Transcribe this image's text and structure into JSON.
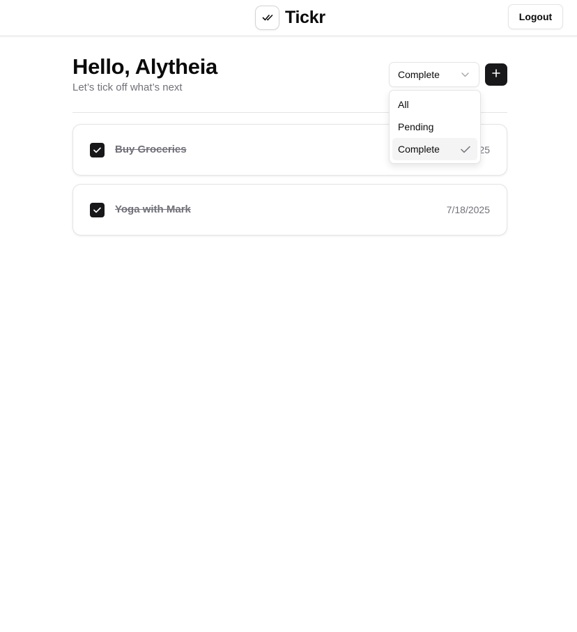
{
  "header": {
    "app_name": "Tickr",
    "logo_icon": "double-check-icon",
    "logout_label": "Logout"
  },
  "main": {
    "greeting": "Hello, Alytheia",
    "subtitle": "Let’s tick off what’s next",
    "filter": {
      "selected": "Complete",
      "options": [
        {
          "label": "All",
          "selected": false
        },
        {
          "label": "Pending",
          "selected": false
        },
        {
          "label": "Complete",
          "selected": true
        }
      ]
    },
    "add_button_icon": "plus-icon",
    "tasks": [
      {
        "title": "Buy Groceries",
        "date": "7/18/2025",
        "completed": true
      },
      {
        "title": "Yoga with Mark",
        "date": "7/18/2025",
        "completed": true
      }
    ]
  },
  "colors": {
    "primary": "#18181b",
    "muted_text": "#71717a",
    "border": "#e4e4e7",
    "selected_option_bg": "#f4f4f5"
  }
}
